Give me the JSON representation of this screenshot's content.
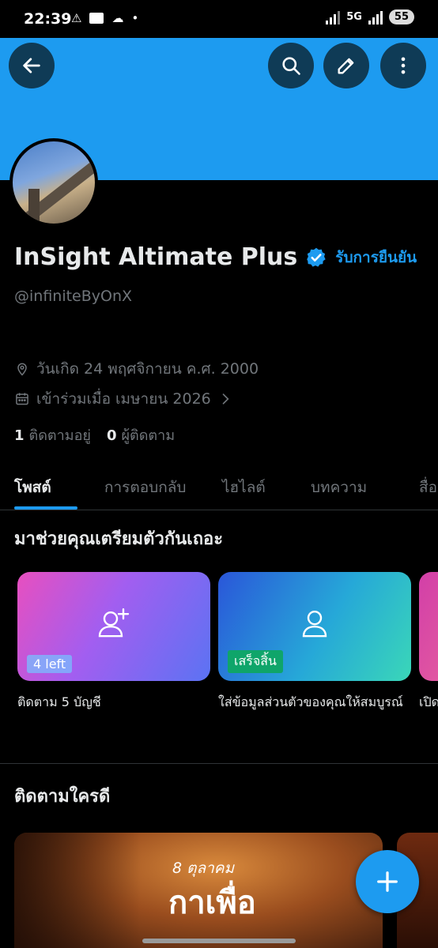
{
  "status_bar": {
    "time": "22:39",
    "network": "5G",
    "battery": "55"
  },
  "colors": {
    "accent": "#1d9bf0",
    "background": "#000000",
    "muted_text": "#71767b"
  },
  "header": {
    "back_icon": "arrow-left-icon",
    "search_icon": "search-icon",
    "edit_icon": "pencil-icon",
    "more_icon": "more-vertical-icon"
  },
  "profile": {
    "display_name": "InSight Altimate Plus",
    "verify_label": "รับการยืนยัน",
    "handle": "@infiniteByOnX",
    "birthday": "วันเกิด 24 พฤศจิกายน ค.ศ. 2000",
    "joined": "เข้าร่วมเมื่อ เมษายน 2026",
    "following_count": "1",
    "following_label": "ติดตามอยู่",
    "followers_count": "0",
    "followers_label": "ผู้ติดตาม"
  },
  "tabs": [
    {
      "label": "โพสต์",
      "active": true
    },
    {
      "label": "การตอบกลับ",
      "active": false
    },
    {
      "label": "ไฮไลต์",
      "active": false
    },
    {
      "label": "บทความ",
      "active": false
    },
    {
      "label": "สื่อ",
      "active": false
    }
  ],
  "setup": {
    "title": "มาช่วยคุณเตรียมตัวกันเถอะ",
    "cards": [
      {
        "badge": "4 left",
        "caption": "ติดตาม 5 บัญชี",
        "icon": "add-user-icon"
      },
      {
        "badge": "เสร็จสิ้น",
        "caption": "ใส่ข้อมูลส่วนตัวของคุณให้สมบูรณ์",
        "icon": "user-icon"
      },
      {
        "caption": "เปิด"
      }
    ]
  },
  "suggestions": {
    "title": "ติดตามใครดี",
    "card_date": "8 ตุลาคม",
    "card_title": "กาเพื่อ"
  },
  "fab": {
    "icon": "plus-icon"
  }
}
